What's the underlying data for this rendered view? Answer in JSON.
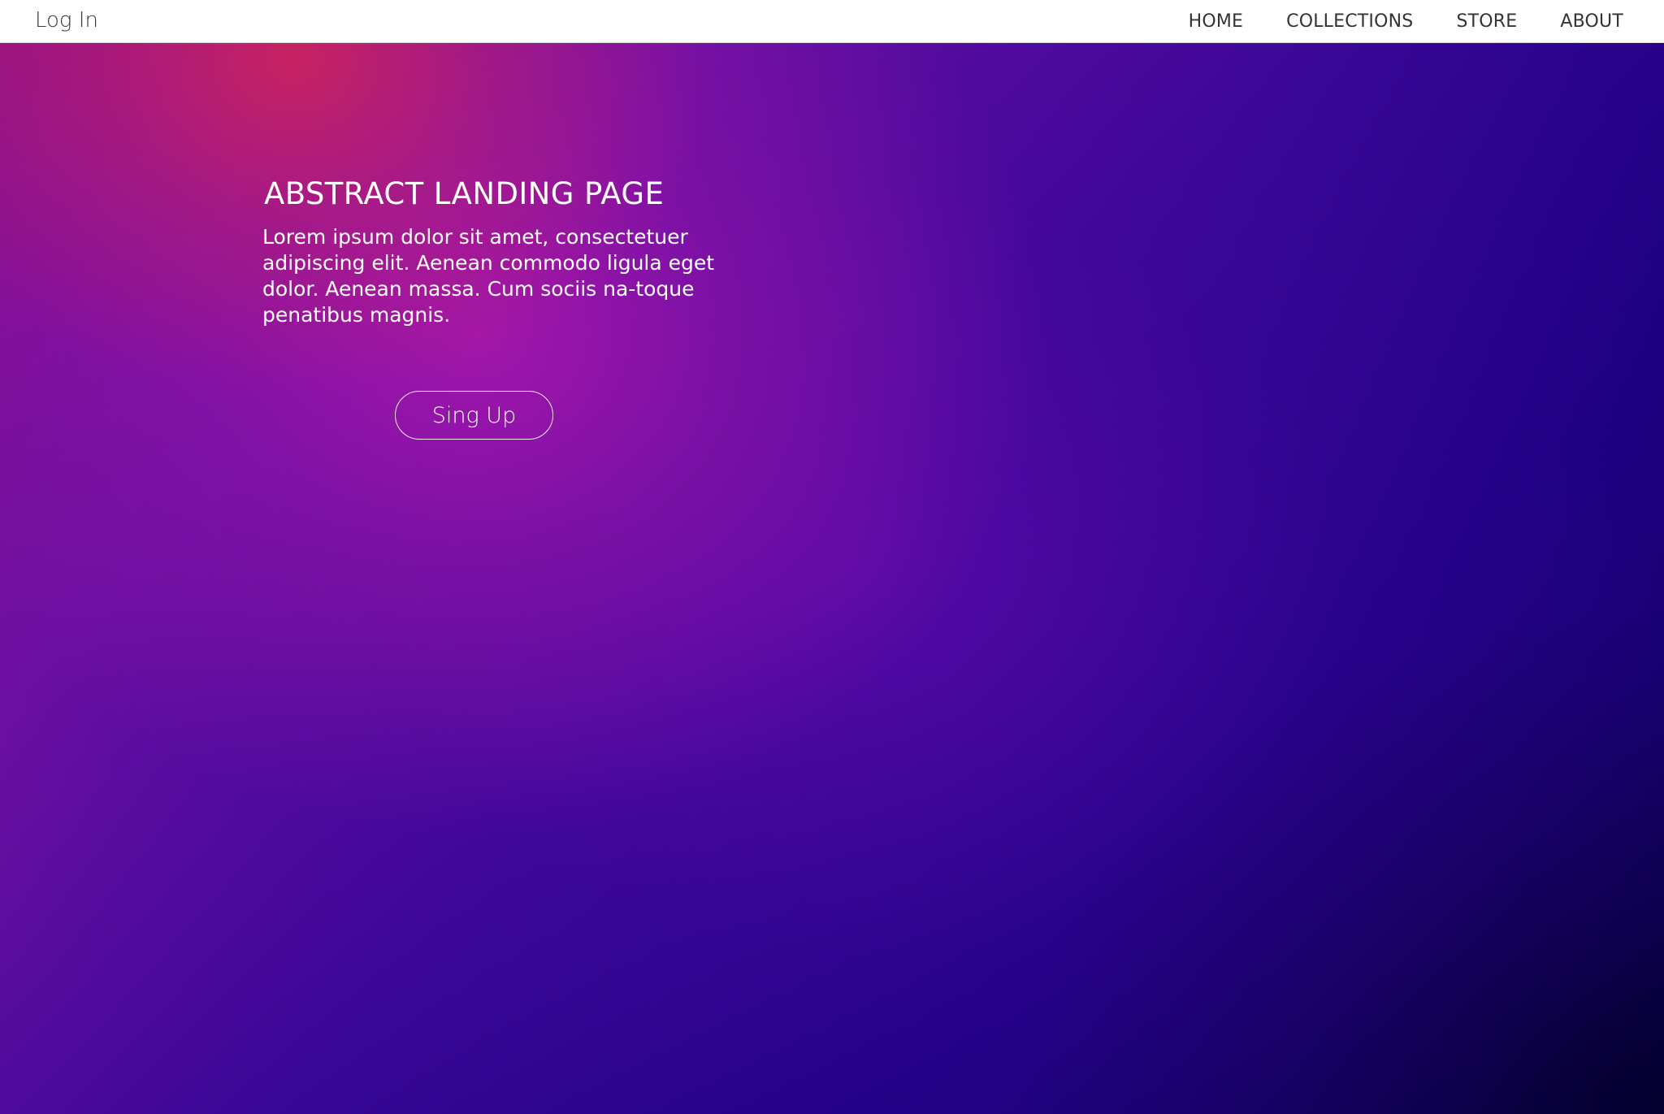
{
  "header": {
    "login_label": "Log In",
    "nav_items": [
      {
        "label": "HOME"
      },
      {
        "label": "COLLECTIONS"
      },
      {
        "label": "STORE"
      },
      {
        "label": "ABOUT"
      }
    ]
  },
  "hero": {
    "title": "ABSTRACT LANDING PAGE",
    "description": "Lorem ipsum dolor sit amet, consectetuer adipiscing elit. Aenean commodo ligula eget dolor. Aenean massa. Cum sociis na-toque penatibus magnis.",
    "signup_label": "Sing Up"
  },
  "colors": {
    "header_background": "#ffffff",
    "header_text": "#333333",
    "hero_pink": "#d62654",
    "hero_magenta": "#a617aa",
    "hero_violet": "#5c0aaa",
    "hero_deep_blue": "#0b005d",
    "hero_text": "#ffffff"
  }
}
